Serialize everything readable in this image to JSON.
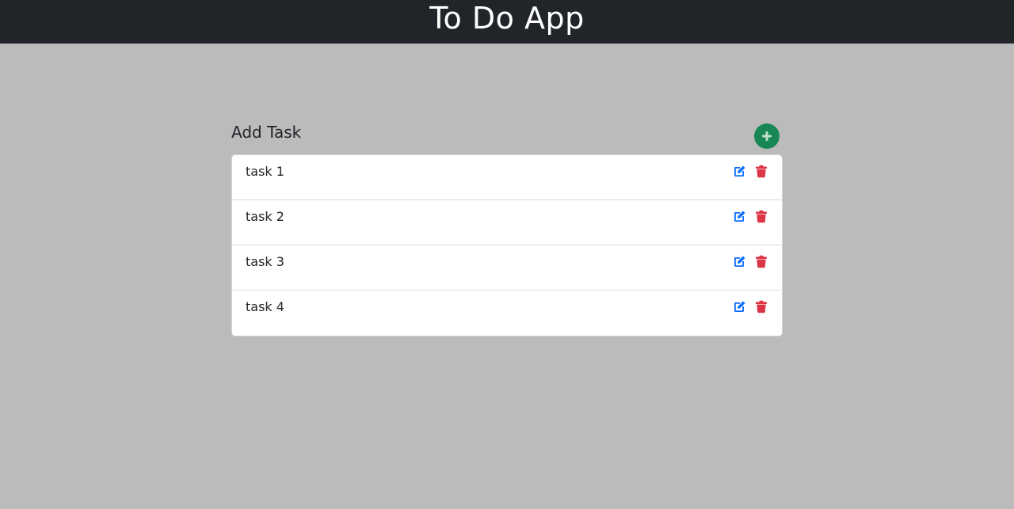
{
  "header": {
    "title": "To Do App"
  },
  "section": {
    "title": "Add Task",
    "add_icon": "plus-icon"
  },
  "tasks": [
    {
      "label": "task 1"
    },
    {
      "label": "task 2"
    },
    {
      "label": "task 3"
    },
    {
      "label": "task 4"
    }
  ],
  "icons": {
    "edit": "edit-icon",
    "delete": "trash-icon"
  },
  "colors": {
    "header_bg": "#212529",
    "page_bg": "#bbbbbb",
    "add_button": "#198754",
    "edit": "#0d6efd",
    "delete": "#dc3545"
  }
}
